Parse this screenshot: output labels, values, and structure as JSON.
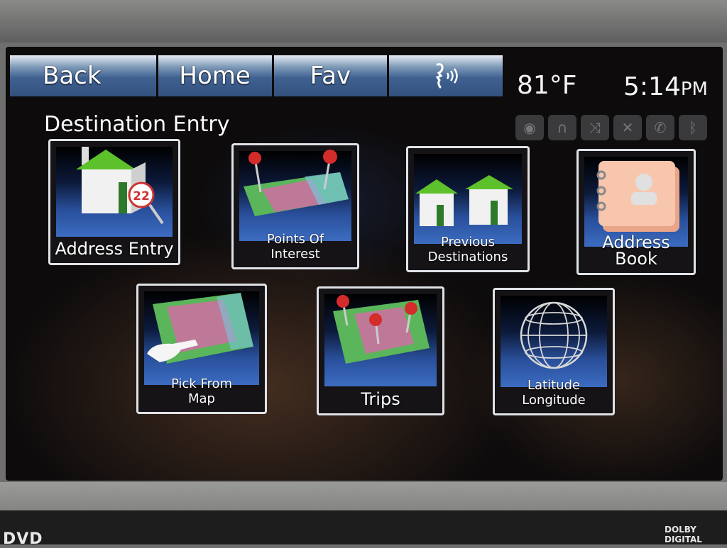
{
  "nav": {
    "back_label": "Back",
    "home_label": "Home",
    "fav_label": "Fav",
    "voice_icon": "voice-command-icon"
  },
  "status": {
    "temperature": "81°F",
    "time": "5:14",
    "ampm": "PM",
    "icons": [
      "radio-icon",
      "headphones-icon",
      "shuffle-icon",
      "mute-icon",
      "phone-icon",
      "bluetooth-icon"
    ]
  },
  "page": {
    "title": "Destination Entry"
  },
  "tiles": [
    {
      "label": "Address Entry"
    },
    {
      "label": "Points Of",
      "label2": "Interest"
    },
    {
      "label": "Previous",
      "label2": "Destinations"
    },
    {
      "label": "Address Book"
    },
    {
      "label": "Pick From",
      "label2": "Map"
    },
    {
      "label": "Trips"
    },
    {
      "label": "Latitude",
      "label2": "Longitude"
    }
  ],
  "house_number": "22",
  "bezel": {
    "left_brand": "DVD",
    "right_brand": "DOLBY",
    "right_brand2": "DIGITAL"
  },
  "colors": {
    "accent": "#3f6191",
    "tile_border": "#dfe2e6",
    "screen_bg": "#0d0b0c"
  }
}
